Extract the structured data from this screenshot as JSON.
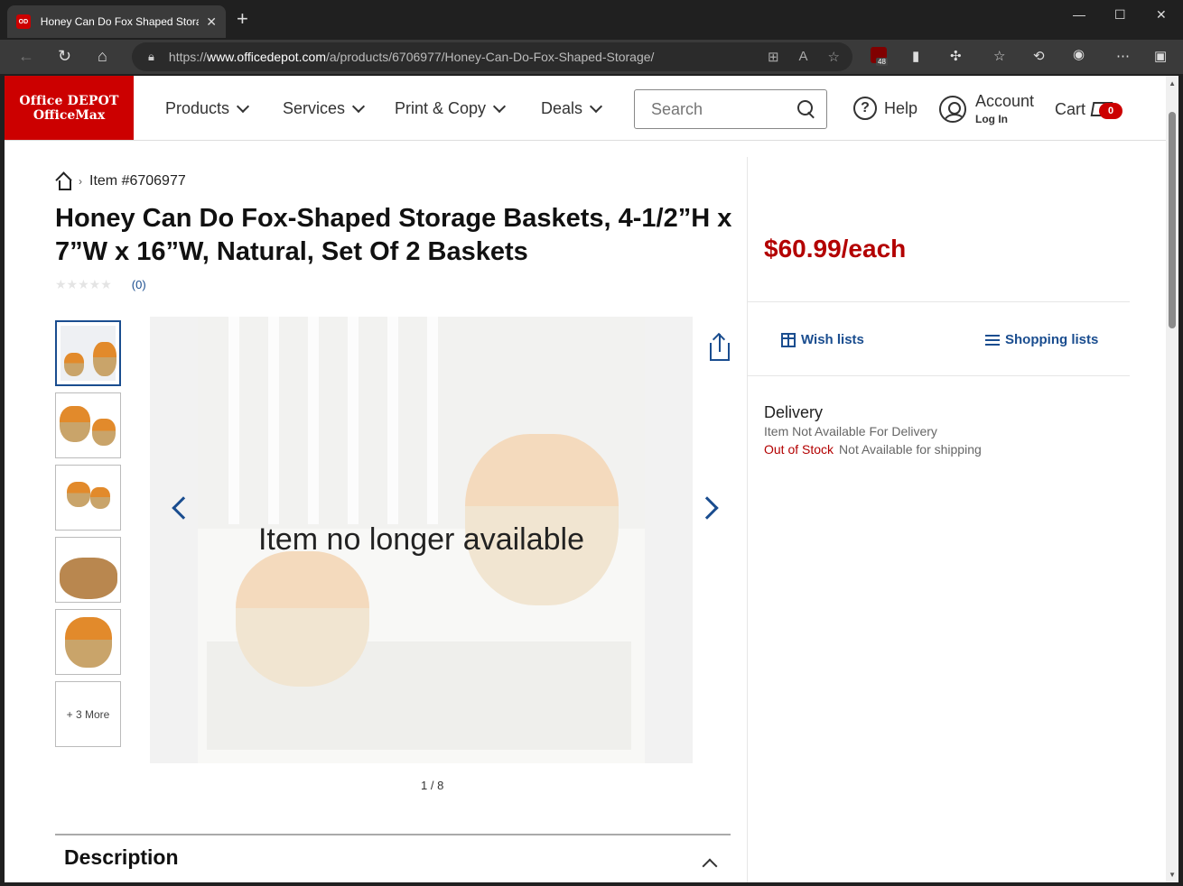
{
  "browser": {
    "tab_title": "Honey Can Do Fox Shaped Storag",
    "tab_favicon": "OD",
    "url_prefix": "https://",
    "url_domain": "www.officedepot.com",
    "url_path": "/a/products/6706977/Honey-Can-Do-Fox-Shaped-Storage/",
    "ublock_count": "48"
  },
  "header": {
    "logo_line1": "Office DEPOT",
    "logo_line2": "OfficeMax",
    "nav": [
      "Products",
      "Services",
      "Print & Copy",
      "Deals"
    ],
    "search_placeholder": "Search",
    "help": "Help",
    "account": "Account",
    "login": "Log In",
    "cart": "Cart",
    "cart_count": "0"
  },
  "product": {
    "item_number": "Item #6706977",
    "title": "Honey Can Do Fox-Shaped Storage Baskets, 4-1/2”H x 7”W x 16”W, Natural, Set Of 2 Baskets",
    "stars": "★★★★★",
    "review_count": "(0)",
    "more_images": "+ 3 More",
    "image_overlay": "Item no longer available",
    "pager": "1 / 8",
    "description_heading": "Description"
  },
  "purchase": {
    "price": "$60.99/each",
    "wish_lists": "Wish lists",
    "shopping_lists": "Shopping lists",
    "delivery_title": "Delivery",
    "delivery_status": "Item Not Available For Delivery",
    "stock_status": "Out of Stock",
    "shipping_status": "Not Available for shipping"
  },
  "colors": {
    "brand_red": "#cc0000",
    "link_blue": "#1a4d8f",
    "price_red": "#b30000"
  }
}
